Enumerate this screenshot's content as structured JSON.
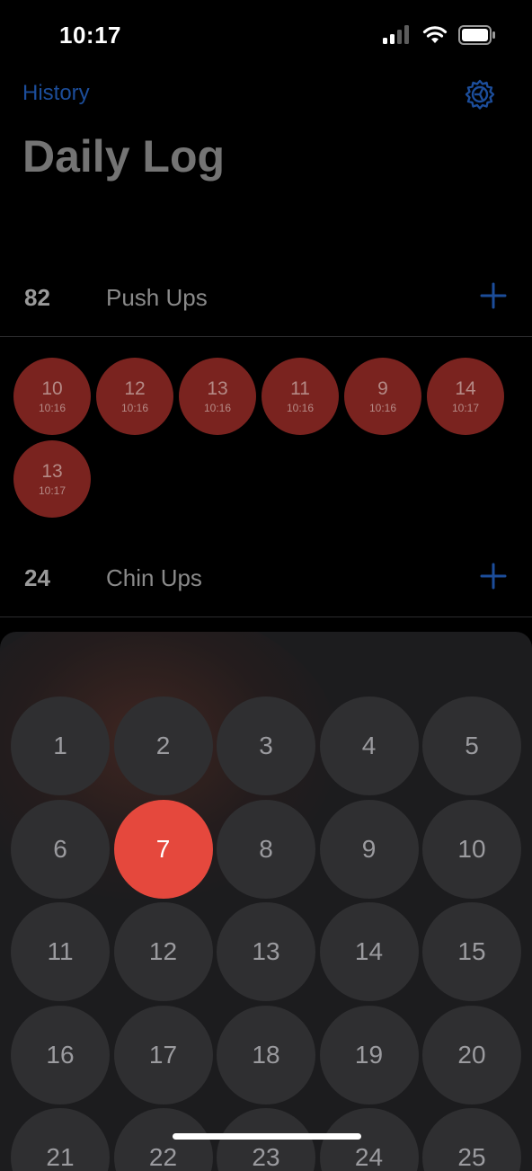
{
  "status_bar": {
    "time": "10:17"
  },
  "nav": {
    "history_label": "History",
    "settings_icon": "gear-icon",
    "title": "Daily Log"
  },
  "colors": {
    "accent": "#1c4d9a",
    "entry_bubble": "#7a231f",
    "selected_key": "#e5483d"
  },
  "exercises": [
    {
      "count": "82",
      "name": "Push Ups",
      "entries": [
        {
          "value": "10",
          "time": "10:16"
        },
        {
          "value": "12",
          "time": "10:16"
        },
        {
          "value": "13",
          "time": "10:16"
        },
        {
          "value": "11",
          "time": "10:16"
        },
        {
          "value": "9",
          "time": "10:16"
        },
        {
          "value": "14",
          "time": "10:17"
        },
        {
          "value": "13",
          "time": "10:17"
        }
      ]
    },
    {
      "count": "24",
      "name": "Chin Ups",
      "entries": []
    }
  ],
  "keypad": {
    "selected": "7",
    "keys": [
      "1",
      "2",
      "3",
      "4",
      "5",
      "6",
      "7",
      "8",
      "9",
      "10",
      "11",
      "12",
      "13",
      "14",
      "15",
      "16",
      "17",
      "18",
      "19",
      "20",
      "21",
      "22",
      "23",
      "24",
      "25"
    ]
  }
}
